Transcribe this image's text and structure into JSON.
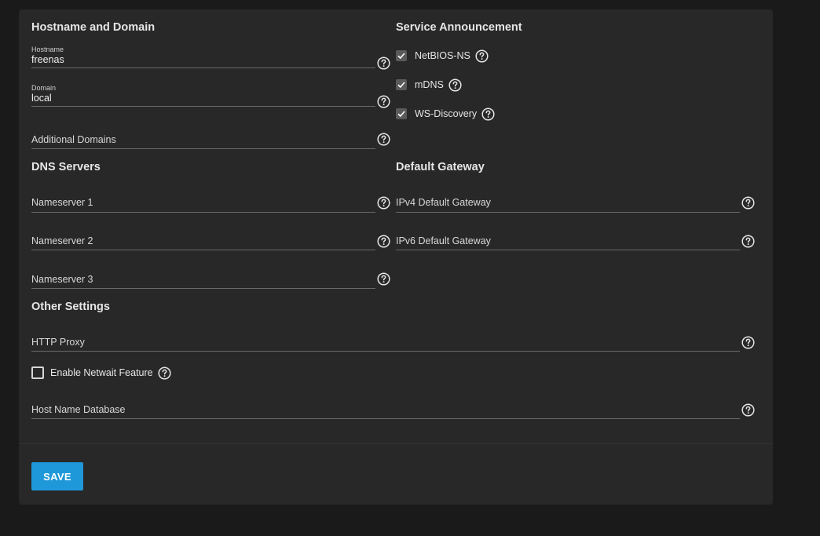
{
  "sections": {
    "hostname_domain": {
      "title": "Hostname and Domain",
      "hostname": {
        "label": "Hostname",
        "value": "freenas"
      },
      "domain": {
        "label": "Domain",
        "value": "local"
      },
      "additional_domains": {
        "placeholder": "Additional Domains"
      }
    },
    "service_announcement": {
      "title": "Service Announcement",
      "netbios_ns": {
        "label": "NetBIOS-NS",
        "checked": true
      },
      "mdns": {
        "label": "mDNS",
        "checked": true
      },
      "ws_discovery": {
        "label": "WS-Discovery",
        "checked": true
      }
    },
    "dns_servers": {
      "title": "DNS Servers",
      "nameserver1": {
        "placeholder": "Nameserver 1"
      },
      "nameserver2": {
        "placeholder": "Nameserver 2"
      },
      "nameserver3": {
        "placeholder": "Nameserver 3"
      }
    },
    "default_gateway": {
      "title": "Default Gateway",
      "ipv4": {
        "placeholder": "IPv4 Default Gateway"
      },
      "ipv6": {
        "placeholder": "IPv6 Default Gateway"
      }
    },
    "other_settings": {
      "title": "Other Settings",
      "http_proxy": {
        "placeholder": "HTTP Proxy"
      },
      "netwait": {
        "label": "Enable Netwait Feature",
        "checked": false
      },
      "host_name_database": {
        "placeholder": "Host Name Database"
      }
    }
  },
  "actions": {
    "save_label": "SAVE"
  },
  "icons": {
    "help": "help-circle-icon",
    "check": "check-icon"
  },
  "colors": {
    "page_bg": "#1a1a1a",
    "card_bg": "#282828",
    "primary": "#1e98d8",
    "text": "#e2e2e2",
    "checkbox_checked_bg": "#5a5a5a"
  }
}
